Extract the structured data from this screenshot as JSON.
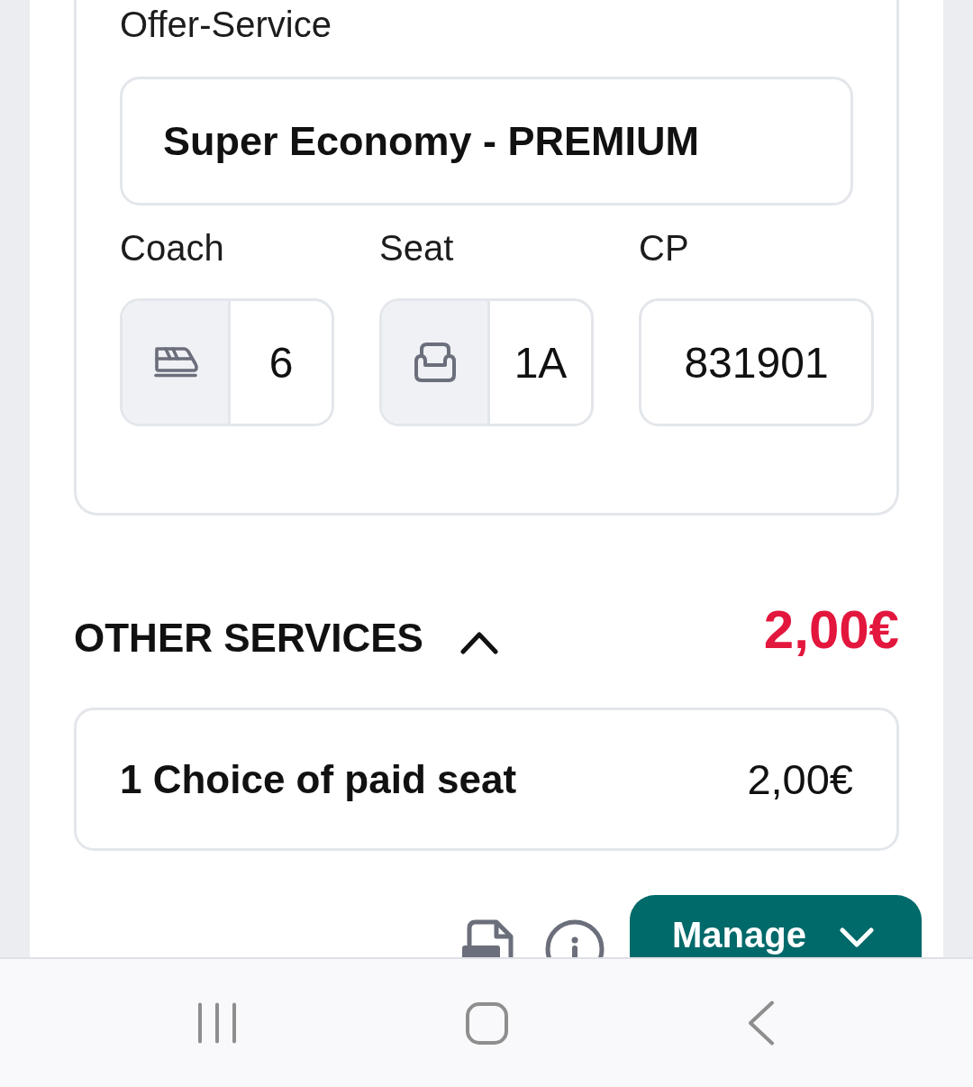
{
  "offer": {
    "label": "Offer-Service",
    "value": "Super Economy - PREMIUM"
  },
  "seat_details": [
    {
      "kind": "coach",
      "label": "Coach",
      "value": "6"
    },
    {
      "kind": "seat",
      "label": "Seat",
      "value": "1A"
    },
    {
      "kind": "plain",
      "label": "CP",
      "value": "831901"
    }
  ],
  "other_services": {
    "title": "OTHER SERVICES",
    "expanded": true,
    "total": "2,00€",
    "items": [
      {
        "name": "1 Choice of paid seat",
        "price": "2,00€"
      }
    ]
  },
  "actions": {
    "manage_button": "Manage"
  }
}
